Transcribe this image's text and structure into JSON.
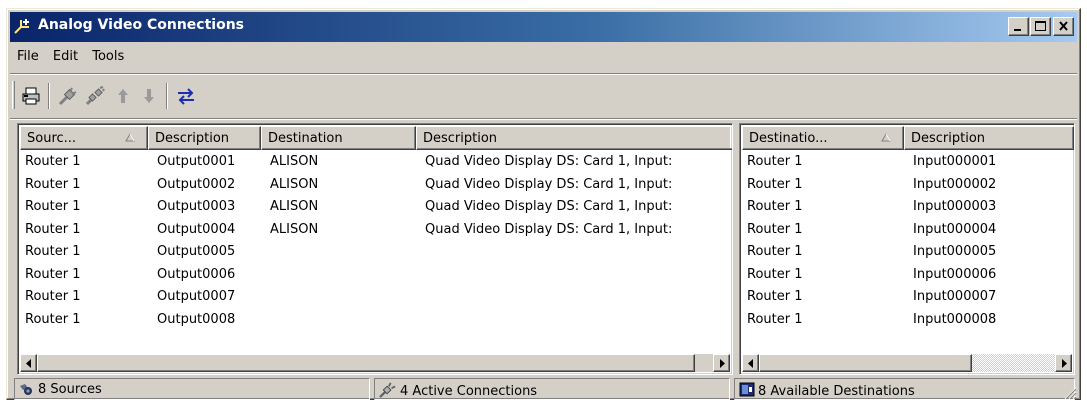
{
  "window": {
    "title": "Analog Video Connections",
    "title_gradient": [
      "#0a246a",
      "#a6caf0"
    ]
  },
  "menu": [
    "File",
    "Edit",
    "Tools"
  ],
  "toolbar": {
    "buttons": [
      "print-icon",
      "connect-icon",
      "disconnect-icon",
      "move-up-icon",
      "move-down-icon",
      "swap-icon"
    ]
  },
  "sources": {
    "columns": [
      "Sourc...",
      "Description",
      "Destination",
      "Description"
    ],
    "rows": [
      [
        "Router 1",
        "Output0001",
        "ALISON",
        "Quad Video Display DS: Card 1, Input:"
      ],
      [
        "Router 1",
        "Output0002",
        "ALISON",
        "Quad Video Display DS: Card 1, Input:"
      ],
      [
        "Router 1",
        "Output0003",
        "ALISON",
        "Quad Video Display DS: Card 1, Input:"
      ],
      [
        "Router 1",
        "Output0004",
        "ALISON",
        "Quad Video Display DS: Card 1, Input:"
      ],
      [
        "Router 1",
        "Output0005",
        "",
        ""
      ],
      [
        "Router 1",
        "Output0006",
        "",
        ""
      ],
      [
        "Router 1",
        "Output0007",
        "",
        ""
      ],
      [
        "Router 1",
        "Output0008",
        "",
        ""
      ]
    ]
  },
  "destinations": {
    "columns": [
      "Destinatio...",
      "Description"
    ],
    "rows": [
      [
        "Router 1",
        "Input000001"
      ],
      [
        "Router 1",
        "Input000002"
      ],
      [
        "Router 1",
        "Input000003"
      ],
      [
        "Router 1",
        "Input000004"
      ],
      [
        "Router 1",
        "Input000005"
      ],
      [
        "Router 1",
        "Input000006"
      ],
      [
        "Router 1",
        "Input000007"
      ],
      [
        "Router 1",
        "Input000008"
      ]
    ]
  },
  "status": {
    "sources": "8 Sources",
    "connections": "4 Active Connections",
    "destinations": "8 Available Destinations"
  }
}
